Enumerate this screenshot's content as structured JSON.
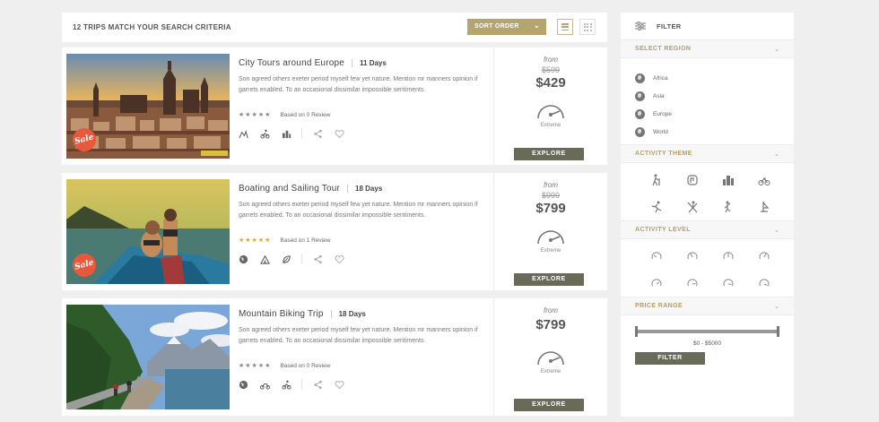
{
  "header": {
    "results_count": "12 TRIPS MATCH YOUR SEARCH CRITERIA",
    "sort_label": "SORT ORDER"
  },
  "trips": [
    {
      "title": "City Tours around Europe",
      "duration": "11 Days",
      "description": "Son agreed others exeter period myself few yet nature. Mention mr manners opinion if garrets enabled. To an occasional dissimilar impossible sentiments.",
      "review_text": "Based on 0 Review",
      "stars": "★★★★★",
      "from_label": "from",
      "old_price": "$599",
      "price": "$429",
      "level": "Extreme",
      "explore_label": "EXPLORE",
      "sale_label": "Sale"
    },
    {
      "title": "Boating and Sailing Tour",
      "duration": "18 Days",
      "description": "Son agreed others exeter period myself few yet nature. Mention mr manners opinion if garrets enabled. To an occasional dissimilar impossible sentiments.",
      "review_text": "Based on 1 Review",
      "stars": "★★★★★",
      "from_label": "from",
      "old_price": "$999",
      "price": "$799",
      "level": "Extreme",
      "explore_label": "EXPLORE",
      "sale_label": "Sale"
    },
    {
      "title": "Mountain Biking Trip",
      "duration": "18 Days",
      "description": "Son agreed others exeter period myself few yet nature. Mention mr manners opinion if garrets enabled. To an occasional dissimilar impossible sentiments.",
      "review_text": "Based on 0 Review",
      "stars": "★★★★★",
      "from_label": "from",
      "price": "$799",
      "level": "Extreme",
      "explore_label": "EXPLORE"
    }
  ],
  "filter": {
    "title": "FILTER",
    "region_label": "SELECT REGION",
    "regions": [
      "Africa",
      "Asia",
      "Europe",
      "World"
    ],
    "theme_label": "ACTIVITY THEME",
    "level_label": "ACTIVITY LEVEL",
    "price_label": "PRICE RANGE",
    "price_range": "$0 - $5000",
    "button_label": "FILTER"
  },
  "colors": {
    "accent": "#b5a46c",
    "button": "#6a6a58",
    "sale": "#e7593a",
    "star_gold": "#e6a21a"
  }
}
